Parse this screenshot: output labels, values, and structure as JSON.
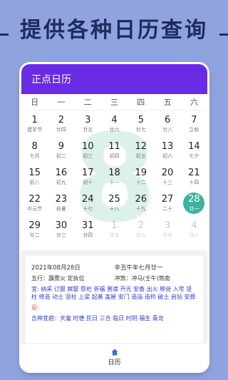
{
  "banner": {
    "title": "提供各种日历查询"
  },
  "app": {
    "title": "正点日历"
  },
  "weekdays": [
    "日",
    "一",
    "二",
    "三",
    "四",
    "五",
    "六"
  ],
  "watermark": "8",
  "calendar": [
    [
      {
        "d": "1",
        "l": "建军节"
      },
      {
        "d": "2",
        "l": "廿四"
      },
      {
        "d": "3",
        "l": "廿五"
      },
      {
        "d": "4",
        "l": "廿六"
      },
      {
        "d": "5",
        "l": "廿七"
      },
      {
        "d": "6",
        "l": "廿八"
      },
      {
        "d": "7",
        "l": "立秋"
      }
    ],
    [
      {
        "d": "8",
        "l": "七月"
      },
      {
        "d": "9",
        "l": "初二"
      },
      {
        "d": "10",
        "l": "初三"
      },
      {
        "d": "11",
        "l": "初四"
      },
      {
        "d": "12",
        "l": "初五"
      },
      {
        "d": "13",
        "l": "初六"
      },
      {
        "d": "14",
        "l": "七夕"
      }
    ],
    [
      {
        "d": "15",
        "l": "初八"
      },
      {
        "d": "16",
        "l": "初九"
      },
      {
        "d": "17",
        "l": "初十"
      },
      {
        "d": "18",
        "l": "十一"
      },
      {
        "d": "19",
        "l": "十二"
      },
      {
        "d": "20",
        "l": "十三"
      },
      {
        "d": "21",
        "l": "十四"
      }
    ],
    [
      {
        "d": "22",
        "l": "中元节"
      },
      {
        "d": "23",
        "l": "处暑"
      },
      {
        "d": "24",
        "l": "十七"
      },
      {
        "d": "25",
        "l": "十八"
      },
      {
        "d": "26",
        "l": "十九"
      },
      {
        "d": "27",
        "l": "二十"
      },
      {
        "d": "28",
        "l": "廿一",
        "sel": true
      }
    ],
    [
      {
        "d": "29",
        "l": "廿二"
      },
      {
        "d": "30",
        "l": "廿三"
      },
      {
        "d": "31",
        "l": "廿四"
      },
      {
        "d": "1",
        "l": "廿五",
        "dim": true
      },
      {
        "d": "2",
        "l": "廿六",
        "dim": true
      },
      {
        "d": "3",
        "l": "廿七",
        "dim": true
      },
      {
        "d": "4",
        "l": "廿八",
        "dim": true
      }
    ]
  ],
  "info": {
    "date": "2021年08月28日",
    "lunar": "辛丑牛年七月廿一",
    "wuxing": "五行：霹雳火 定执位",
    "chong": "冲煞：冲马(壬午)煞南",
    "yi": "宜: 纳采 订盟 嫁娶 祭祀 祈福 普渡 开光 安香 出火 移徙 入宅 竖柱 修造 动土 竖柱 上梁 起基 盖屋 安门 造庙 造桥 破土 启钻 安葬",
    "ji": "忌:",
    "shen": "吉神宜趋：天富 时德 民日 三合 临日 时阴 福生 青龙"
  },
  "tabbar": {
    "label": "日历",
    "icon": "home-icon"
  },
  "colors": {
    "appbar": "#6A2BE4",
    "selected": "#3DB39E",
    "background": "#8FA3DF"
  }
}
